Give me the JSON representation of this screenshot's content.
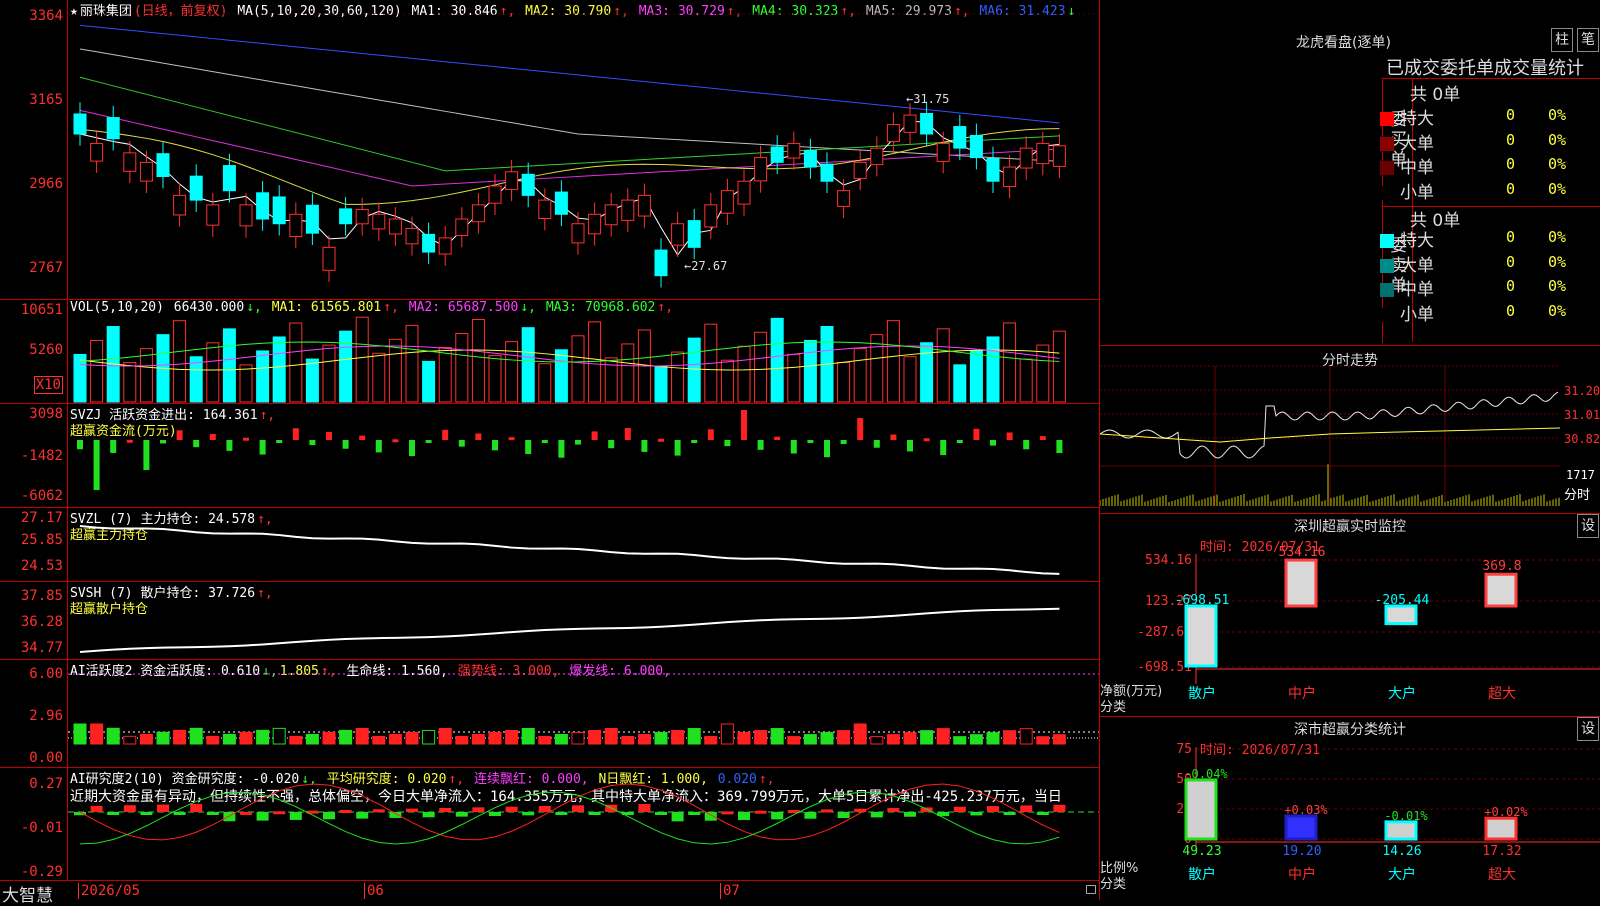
{
  "header": {
    "stock_name": "丽珠集团",
    "period": "(日线，前复权)",
    "ma_label": "MA(5,10,20,30,60,120)",
    "ma1": "MA1: 30.846",
    "ma2": "MA2: 30.790",
    "ma3": "MA3: 30.729",
    "ma4": "MA4: 30.323",
    "ma5": "MA5: 29.973",
    "ma6": "MA6: 31.423"
  },
  "price_axis": [
    "3364",
    "3165",
    "2966",
    "2767"
  ],
  "price_annotations": {
    "high": "31.75",
    "low": "←27.67"
  },
  "vol": {
    "label": "VOL(5,10,20)",
    "value": "66430.000",
    "ma1": "MA1: 61565.801",
    "ma2": "MA2: 65687.500",
    "ma3": "MA3: 70968.602",
    "axis": [
      "10651",
      "5260"
    ],
    "unit": "X10"
  },
  "svzj": {
    "label": "SVZJ  活跃资金进出: 164.361",
    "sub": "超赢资金流(万元)",
    "axis": [
      "3098",
      "-1482",
      "-6062"
    ]
  },
  "svzl": {
    "label": "SVZL (7) 主力持仓: 24.578",
    "sub": "超赢主力持仓",
    "axis": [
      "27.17",
      "25.85",
      "24.53"
    ]
  },
  "svsh": {
    "label": "SVSH (7) 散户持仓: 37.726",
    "sub": "超赢散户持仓",
    "axis": [
      "37.85",
      "36.28",
      "34.77"
    ]
  },
  "ai1": {
    "label": "AI活跃度2 资金活跃度: 0.610",
    "v2": "1.805",
    "life": "生命线: 1.560,",
    "strong": "强势线: 3.000,",
    "burst": "爆发线: 6.000,",
    "axis": [
      "6.00",
      "2.96",
      "0.00"
    ]
  },
  "ai2": {
    "label": "AI研究度2(10) 资金研究度: -0.020",
    "avg": "平均研究度: 0.020",
    "red": "连续飘红: 0.000,",
    "nred": "N日飘红: 1.000,",
    "tail": "0.020",
    "text": "近期大资金虽有异动，但持续性不强，总体偏空，今日大单净流入：164.355万元，其中特大单净流入：369.799万元，大单5日累计净出-425.237万元，当日",
    "axis": [
      "0.27",
      "-0.01",
      "-0.29"
    ]
  },
  "bottom": {
    "brand": "大智慧",
    "dates": [
      "2026/05",
      "06",
      "07"
    ]
  },
  "right": {
    "lhb_title": "龙虎看盘(逐单)",
    "btn_zhu": "柱",
    "btn_bi": "笔",
    "stat_title": "已成交委托单成交量统计",
    "buy_label": "委买单",
    "sell_label": "委卖单",
    "buy_total": "共 0单",
    "sell_total": "共 0单",
    "buy_rows": [
      {
        "name": "特大",
        "n": "0",
        "p": "0%",
        "color": "#ff0000"
      },
      {
        "name": "大单",
        "n": "0",
        "p": "0%",
        "color": "#8b0000"
      },
      {
        "name": "中单",
        "n": "0",
        "p": "0%",
        "color": "#6b0000"
      },
      {
        "name": "小单",
        "n": "0",
        "p": "0%",
        "color": "#000000"
      }
    ],
    "sell_rows": [
      {
        "name": "特大",
        "n": "0",
        "p": "0%",
        "color": "#00ffff"
      },
      {
        "name": "大单",
        "n": "0",
        "p": "0%",
        "color": "#008b8b"
      },
      {
        "name": "中单",
        "n": "0",
        "p": "0%",
        "color": "#007070"
      },
      {
        "name": "小单",
        "n": "0",
        "p": "0%",
        "color": "#000000"
      }
    ],
    "fs_title": "分时走势",
    "fs_axis": [
      "31.20",
      "31.01",
      "30.82",
      "1717"
    ],
    "fs_unit": "分时",
    "monitor_title": "深圳超赢实时监控",
    "monitor_time": "时间: 2026/07/31",
    "monitor_axis": [
      "534.16",
      "123.27",
      "-287.62",
      "-698.51"
    ],
    "monitor_ylabel": "净额(万元)",
    "monitor_xlabel": "分类",
    "monitor_btn": "设",
    "monitor_bars": [
      {
        "name": "散户",
        "value": "-698.51"
      },
      {
        "name": "中户",
        "value": "534.16"
      },
      {
        "name": "大户",
        "value": "-205.44"
      },
      {
        "name": "超大",
        "value": "369.8"
      }
    ],
    "class_title": "深市超赢分类统计",
    "class_time": "时间: 2026/07/31",
    "class_axis": [
      "75",
      "50",
      "25",
      "0"
    ],
    "class_ylabel": "比例%",
    "class_xlabel": "分类",
    "class_btn": "设",
    "class_bars": [
      {
        "name": "散户",
        "value": "49.23",
        "delta": "-0.04%"
      },
      {
        "name": "中户",
        "value": "19.20",
        "delta": "+0.03%"
      },
      {
        "name": "大户",
        "value": "14.26",
        "delta": "-0.01%"
      },
      {
        "name": "超大",
        "value": "17.32",
        "delta": "+0.02%"
      }
    ]
  }
}
